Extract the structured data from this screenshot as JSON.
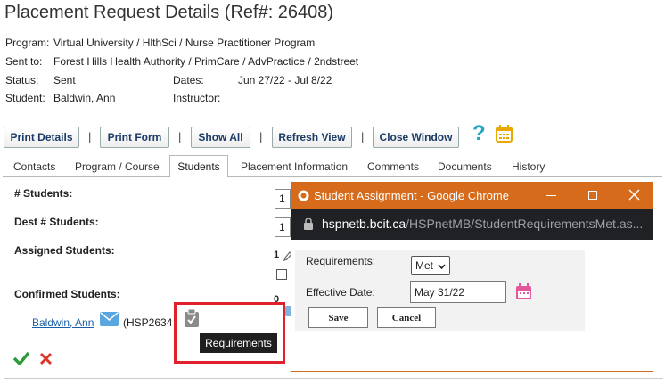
{
  "page": {
    "title": "Placement Request Details (Ref#: 26408)"
  },
  "info": {
    "program_label": "Program:",
    "program_value": "Virtual University / HlthSci / Nurse Practitioner Program",
    "sent_to_label": "Sent to:",
    "sent_to_value": "Forest Hills Health Authority / PrimCare / AdvPractice / 2ndstreet",
    "status_label": "Status:",
    "status_value": "Sent",
    "dates_label": "Dates:",
    "dates_value": "Jun 27/22 - Jul 8/22",
    "student_label": "Student:",
    "student_value": "Baldwin, Ann",
    "instructor_label": "Instructor:"
  },
  "toolbar": {
    "print_details": "Print Details",
    "print_form": "Print Form",
    "show_all": "Show All",
    "refresh_view": "Refresh View",
    "close_window": "Close Window",
    "separator": "|",
    "help_icon": "?"
  },
  "tabs": [
    "Contacts",
    "Program / Course",
    "Students",
    "Placement Information",
    "Comments",
    "Documents",
    "History"
  ],
  "students": {
    "num_students_label": "# Students:",
    "num_students_value": "1",
    "dest_num_label": "Dest # Students:",
    "dest_num_value": "1",
    "assigned_label": "Assigned Students:",
    "assigned_count": "1",
    "confirmed_label": "Confirmed Students:",
    "confirmed_count": "0",
    "student_link": "Baldwin, Ann",
    "student_id": "(HSP2634",
    "tooltip": "Requirements"
  },
  "popup": {
    "title": "Student Assignment - Google Chrome",
    "url_domain": "hspnetb.bcit.ca",
    "url_path": "/HSPnetMB/StudentRequirementsMet.as...",
    "requirements_label": "Requirements:",
    "requirements_value": "Met",
    "effective_date_label": "Effective Date:",
    "effective_date_value": "May 31/22",
    "save_label": "Save",
    "cancel_label": "Cancel"
  },
  "colors": {
    "accent_orange": "#d56b1b",
    "link_blue": "#1a5fa8",
    "check_green": "#2e9b3a",
    "cross_red": "#d9372a",
    "highlight_red": "#e0202a"
  }
}
